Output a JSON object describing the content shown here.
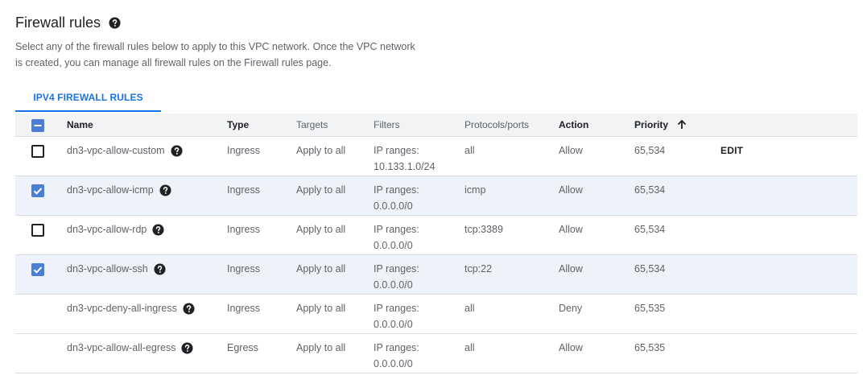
{
  "page": {
    "title": "Firewall rules",
    "description_line1": "Select any of the firewall rules below to apply to this VPC network. Once the VPC network",
    "description_line2": "is created, you can manage all firewall rules on the Firewall rules page."
  },
  "tabs": [
    {
      "label": "IPV4 FIREWALL RULES",
      "active": true
    }
  ],
  "table": {
    "headers": {
      "name": "Name",
      "type": "Type",
      "targets": "Targets",
      "filters": "Filters",
      "protocols": "Protocols/ports",
      "action": "Action",
      "priority": "Priority"
    },
    "select_all_state": "indeterminate",
    "sort": {
      "column": "priority",
      "direction": "ascending"
    },
    "edit_label": "EDIT",
    "rows": [
      {
        "name": "dn3-vpc-allow-custom",
        "type": "Ingress",
        "targets": "Apply to all",
        "filters_label": "IP ranges:",
        "filters_value": "10.133.1.0/24",
        "protocols": "all",
        "action": "Allow",
        "priority": "65,534",
        "checkbox": "unchecked",
        "selected": false,
        "editable": true
      },
      {
        "name": "dn3-vpc-allow-icmp",
        "type": "Ingress",
        "targets": "Apply to all",
        "filters_label": "IP ranges:",
        "filters_value": "0.0.0.0/0",
        "protocols": "icmp",
        "action": "Allow",
        "priority": "65,534",
        "checkbox": "checked",
        "selected": true,
        "editable": false
      },
      {
        "name": "dn3-vpc-allow-rdp",
        "type": "Ingress",
        "targets": "Apply to all",
        "filters_label": "IP ranges:",
        "filters_value": "0.0.0.0/0",
        "protocols": "tcp:3389",
        "action": "Allow",
        "priority": "65,534",
        "checkbox": "unchecked",
        "selected": false,
        "editable": false
      },
      {
        "name": "dn3-vpc-allow-ssh",
        "type": "Ingress",
        "targets": "Apply to all",
        "filters_label": "IP ranges:",
        "filters_value": "0.0.0.0/0",
        "protocols": "tcp:22",
        "action": "Allow",
        "priority": "65,534",
        "checkbox": "checked",
        "selected": true,
        "editable": false
      },
      {
        "name": "dn3-vpc-deny-all-ingress",
        "type": "Ingress",
        "targets": "Apply to all",
        "filters_label": "IP ranges:",
        "filters_value": "0.0.0.0/0",
        "protocols": "all",
        "action": "Deny",
        "priority": "65,535",
        "checkbox": "none",
        "selected": false,
        "editable": false
      },
      {
        "name": "dn3-vpc-allow-all-egress",
        "type": "Egress",
        "targets": "Apply to all",
        "filters_label": "IP ranges:",
        "filters_value": "0.0.0.0/0",
        "protocols": "all",
        "action": "Allow",
        "priority": "65,535",
        "checkbox": "none",
        "selected": false,
        "editable": false
      }
    ]
  },
  "icons": {
    "help": "help-circle-icon",
    "sort": "arrow-up-icon",
    "checkbox_checked": "checkbox-checked-icon",
    "checkbox_indeterminate": "checkbox-indeterminate-icon"
  },
  "colors": {
    "accent": "#1a73e8",
    "checkbox": "#4a7dd6",
    "selected_row": "#eef3fb",
    "header_bg": "#f1f3f4",
    "divider": "#dadce0"
  }
}
